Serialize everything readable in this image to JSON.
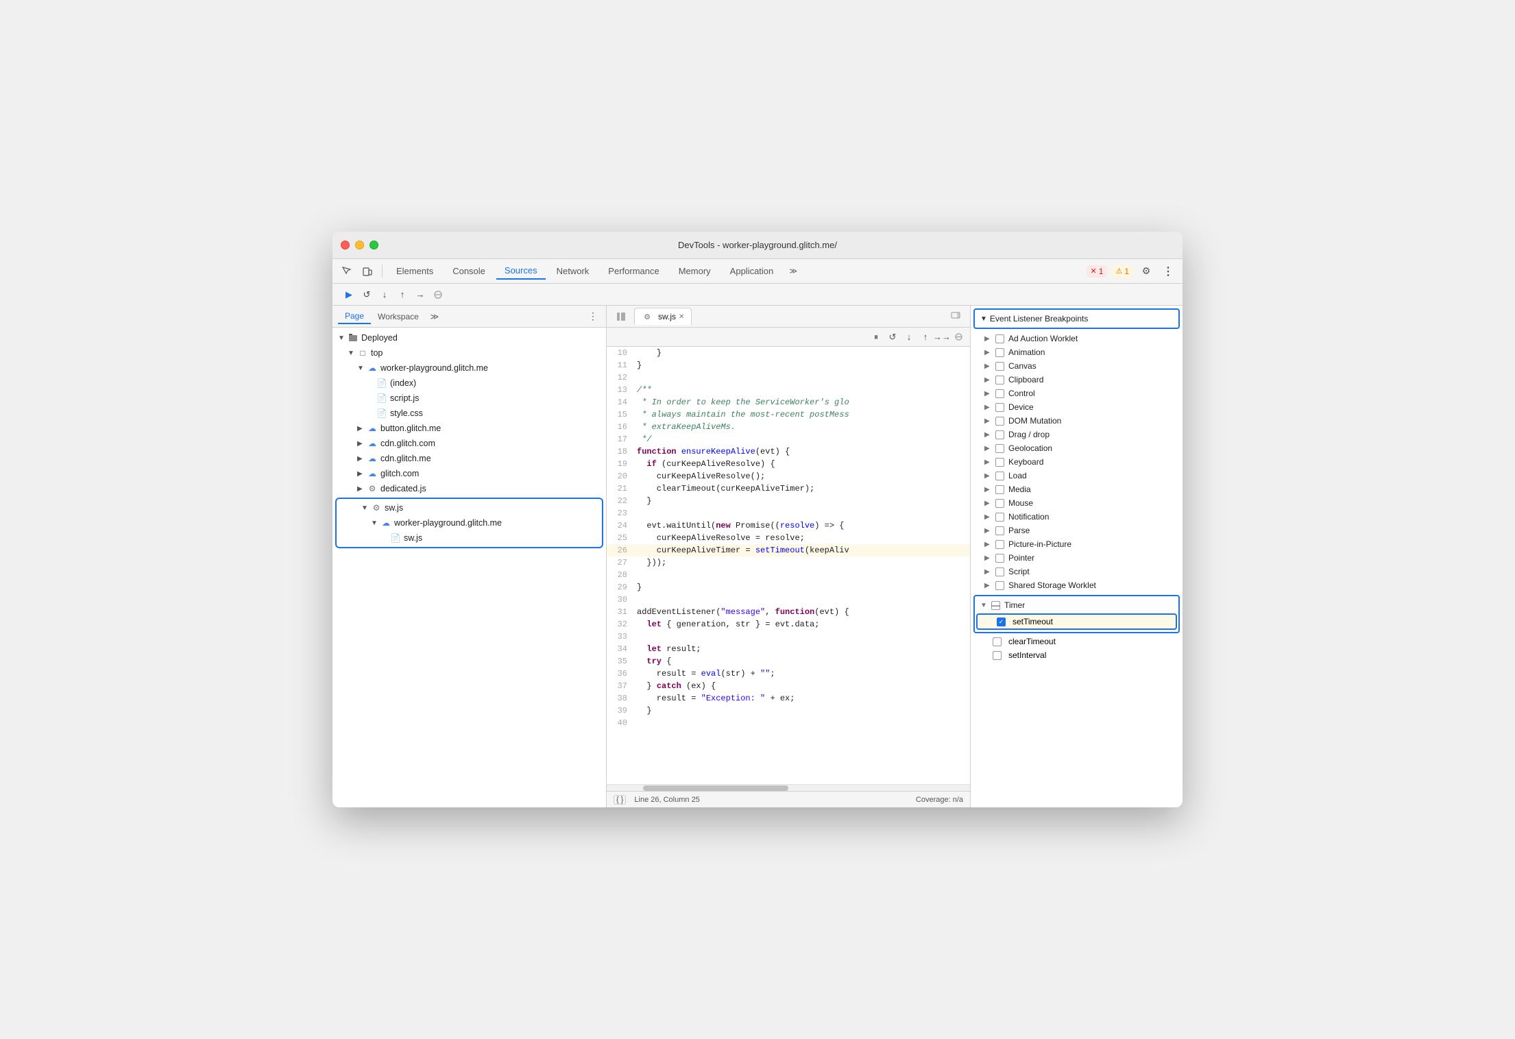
{
  "window": {
    "title": "DevTools - worker-playground.glitch.me/"
  },
  "toolbar": {
    "tabs": [
      {
        "id": "elements",
        "label": "Elements",
        "active": false
      },
      {
        "id": "console",
        "label": "Console",
        "active": false
      },
      {
        "id": "sources",
        "label": "Sources",
        "active": true
      },
      {
        "id": "network",
        "label": "Network",
        "active": false
      },
      {
        "id": "performance",
        "label": "Performance",
        "active": false
      },
      {
        "id": "memory",
        "label": "Memory",
        "active": false
      },
      {
        "id": "application",
        "label": "Application",
        "active": false
      }
    ],
    "error_count": "1",
    "warning_count": "1"
  },
  "sources_tabs": [
    {
      "id": "page",
      "label": "Page",
      "active": true
    },
    {
      "id": "workspace",
      "label": "Workspace",
      "active": false
    }
  ],
  "file_tree": {
    "items": [
      {
        "level": 0,
        "type": "folder",
        "label": "Deployed",
        "expanded": true,
        "icon": "cube"
      },
      {
        "level": 1,
        "type": "folder",
        "label": "top",
        "expanded": true,
        "icon": "folder"
      },
      {
        "level": 2,
        "type": "cloud-folder",
        "label": "worker-playground.glitch.me",
        "expanded": true,
        "icon": "cloud"
      },
      {
        "level": 3,
        "type": "file",
        "label": "(index)",
        "icon": "file"
      },
      {
        "level": 3,
        "type": "file",
        "label": "script.js",
        "icon": "js"
      },
      {
        "level": 3,
        "type": "file",
        "label": "style.css",
        "icon": "css"
      },
      {
        "level": 2,
        "type": "cloud-folder",
        "label": "button.glitch.me",
        "expanded": false,
        "icon": "cloud"
      },
      {
        "level": 2,
        "type": "cloud-folder",
        "label": "cdn.glitch.com",
        "expanded": false,
        "icon": "cloud"
      },
      {
        "level": 2,
        "type": "cloud-folder",
        "label": "cdn.glitch.me",
        "expanded": false,
        "icon": "cloud"
      },
      {
        "level": 2,
        "type": "cloud-folder",
        "label": "glitch.com",
        "expanded": false,
        "icon": "cloud"
      },
      {
        "level": 2,
        "type": "gear-file",
        "label": "dedicated.js",
        "icon": "gear-file"
      }
    ],
    "selected_group": {
      "items": [
        {
          "label": "sw.js",
          "icon": "gear-file"
        },
        {
          "label": "worker-playground.glitch.me",
          "icon": "cloud"
        },
        {
          "label": "sw.js",
          "icon": "js-file"
        }
      ]
    }
  },
  "editor": {
    "tab": "sw.js",
    "lines": [
      {
        "num": 10,
        "content": "    }",
        "highlighted": false
      },
      {
        "num": 11,
        "content": "}",
        "highlighted": false
      },
      {
        "num": 12,
        "content": "",
        "highlighted": false
      },
      {
        "num": 13,
        "content": "/**",
        "highlighted": false,
        "type": "comment"
      },
      {
        "num": 14,
        "content": " * In order to keep the ServiceWorker's glo",
        "highlighted": false,
        "type": "comment"
      },
      {
        "num": 15,
        "content": " * always maintain the most-recent postMess",
        "highlighted": false,
        "type": "comment"
      },
      {
        "num": 16,
        "content": " * extraKeepAliveMs.",
        "highlighted": false,
        "type": "comment"
      },
      {
        "num": 17,
        "content": " */",
        "highlighted": false,
        "type": "comment"
      },
      {
        "num": 18,
        "content": "function ensureKeepAlive(evt) {",
        "highlighted": false
      },
      {
        "num": 19,
        "content": "  if (curKeepAliveResolve) {",
        "highlighted": false
      },
      {
        "num": 20,
        "content": "    curKeepAliveResolve();",
        "highlighted": false
      },
      {
        "num": 21,
        "content": "    clearTimeout(curKeepAliveTimer);",
        "highlighted": false
      },
      {
        "num": 22,
        "content": "  }",
        "highlighted": false
      },
      {
        "num": 23,
        "content": "",
        "highlighted": false
      },
      {
        "num": 24,
        "content": "  evt.waitUntil(new Promise((resolve) => {",
        "highlighted": false
      },
      {
        "num": 25,
        "content": "    curKeepAliveResolve = resolve;",
        "highlighted": false
      },
      {
        "num": 26,
        "content": "    curKeepAliveTimer = setTimeout(keepAliv",
        "highlighted": true
      },
      {
        "num": 27,
        "content": "  }));",
        "highlighted": false
      },
      {
        "num": 28,
        "content": "",
        "highlighted": false
      },
      {
        "num": 29,
        "content": "}",
        "highlighted": false
      },
      {
        "num": 30,
        "content": "",
        "highlighted": false
      },
      {
        "num": 31,
        "content": "addEventListener(\"message\", function(evt) {",
        "highlighted": false
      },
      {
        "num": 32,
        "content": "  let { generation, str } = evt.data;",
        "highlighted": false
      },
      {
        "num": 33,
        "content": "",
        "highlighted": false
      },
      {
        "num": 34,
        "content": "  let result;",
        "highlighted": false
      },
      {
        "num": 35,
        "content": "  try {",
        "highlighted": false
      },
      {
        "num": 36,
        "content": "    result = eval(str) + \"\";",
        "highlighted": false
      },
      {
        "num": 37,
        "content": "  } catch (ex) {",
        "highlighted": false
      },
      {
        "num": 38,
        "content": "    result = \"Exception: \" + ex;",
        "highlighted": false
      },
      {
        "num": 39,
        "content": "  }",
        "highlighted": false
      },
      {
        "num": 40,
        "content": "",
        "highlighted": false
      }
    ],
    "status_bar": {
      "format_icon": "{ }",
      "position": "Line 26, Column 25",
      "coverage": "Coverage: n/a"
    }
  },
  "breakpoints": {
    "section_title": "Event Listener Breakpoints",
    "items": [
      {
        "label": "Ad Auction Worklet",
        "checked": false,
        "expanded": false
      },
      {
        "label": "Animation",
        "checked": false,
        "expanded": false
      },
      {
        "label": "Canvas",
        "checked": false,
        "expanded": false
      },
      {
        "label": "Clipboard",
        "checked": false,
        "expanded": false
      },
      {
        "label": "Control",
        "checked": false,
        "expanded": false
      },
      {
        "label": "Device",
        "checked": false,
        "expanded": false
      },
      {
        "label": "DOM Mutation",
        "checked": false,
        "expanded": false
      },
      {
        "label": "Drag / drop",
        "checked": false,
        "expanded": false
      },
      {
        "label": "Geolocation",
        "checked": false,
        "expanded": false
      },
      {
        "label": "Keyboard",
        "checked": false,
        "expanded": false
      },
      {
        "label": "Load",
        "checked": false,
        "expanded": false
      },
      {
        "label": "Media",
        "checked": false,
        "expanded": false
      },
      {
        "label": "Mouse",
        "checked": false,
        "expanded": false
      },
      {
        "label": "Notification",
        "checked": false,
        "expanded": false
      },
      {
        "label": "Parse",
        "checked": false,
        "expanded": false
      },
      {
        "label": "Picture-in-Picture",
        "checked": false,
        "expanded": false
      },
      {
        "label": "Pointer",
        "checked": false,
        "expanded": false
      },
      {
        "label": "Script",
        "checked": false,
        "expanded": false
      },
      {
        "label": "Shared Storage Worklet",
        "checked": false,
        "expanded": false
      }
    ],
    "timer": {
      "label": "Timer",
      "expanded": true,
      "items": [
        {
          "label": "setTimeout",
          "checked": true,
          "highlighted": true
        },
        {
          "label": "clearTimeout",
          "checked": false,
          "highlighted": false
        },
        {
          "label": "setInterval",
          "checked": false,
          "highlighted": false
        }
      ]
    }
  }
}
